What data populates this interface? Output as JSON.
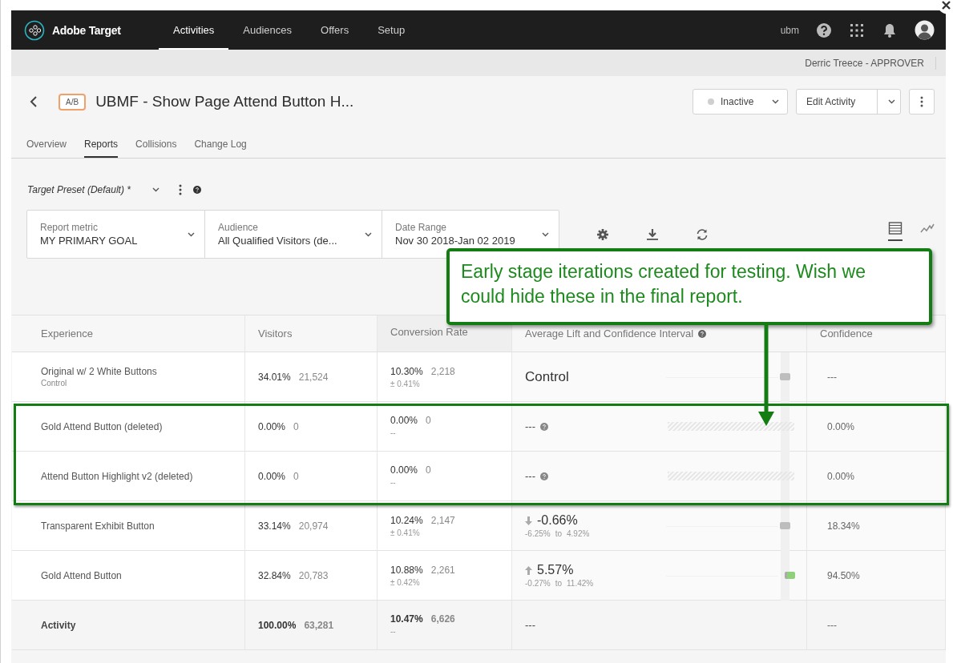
{
  "app": {
    "name": "Adobe Target"
  },
  "nav": [
    {
      "label": "Activities",
      "selected": true
    },
    {
      "label": "Audiences",
      "selected": false
    },
    {
      "label": "Offers",
      "selected": false
    },
    {
      "label": "Setup",
      "selected": false
    }
  ],
  "account": {
    "org": "ubm"
  },
  "user": {
    "name": "Derric Treece - APPROVER"
  },
  "activity": {
    "type": "A/B",
    "title": "UBMF - Show Page Attend Button H...",
    "status": "Inactive",
    "edit_button": "Edit Activity"
  },
  "tabs": [
    {
      "label": "Overview",
      "selected": false
    },
    {
      "label": "Reports",
      "selected": true
    },
    {
      "label": "Collisions",
      "selected": false
    },
    {
      "label": "Change Log",
      "selected": false
    }
  ],
  "preset": {
    "label": "Target Preset (Default) *"
  },
  "filters": [
    {
      "label": "Report metric",
      "value": "MY PRIMARY GOAL"
    },
    {
      "label": "Audience",
      "value": "All Qualified Visitors (de..."
    },
    {
      "label": "Date Range",
      "value": "Nov 30 2018-Jan 02 2019"
    }
  ],
  "views": [
    {
      "kind": "table",
      "selected": true
    },
    {
      "kind": "chart",
      "selected": false
    }
  ],
  "table": {
    "columns": [
      {
        "label": "Experience",
        "sorted": false,
        "help": false
      },
      {
        "label": "Visitors",
        "sorted": false,
        "help": false
      },
      {
        "label": "Conversion Rate",
        "sorted": true,
        "help": false
      },
      {
        "label": "Average Lift and Confidence Interval",
        "sorted": false,
        "help": true
      },
      {
        "label": "Confidence",
        "sorted": false,
        "help": false
      }
    ],
    "rows": [
      {
        "kind": "control",
        "name": "Original w/ 2 White Buttons",
        "note": "Control",
        "visitors_pct": "34.01%",
        "visitors": "21,524",
        "rate": "10.30%",
        "conversions": "2,218",
        "rate_interval": "± 0.41%",
        "lift": "Control",
        "confidence": "---",
        "highlighted": false
      },
      {
        "kind": "empty",
        "name": "Gold Attend Button (deleted)",
        "visitors_pct": "0.00%",
        "visitors": "0",
        "rate": "0.00%",
        "conversions": "0",
        "rate_interval": "--",
        "lift": "---",
        "confidence": "0.00%",
        "highlighted": true
      },
      {
        "kind": "empty",
        "name": "Attend Button Highlight v2 (deleted)",
        "visitors_pct": "0.00%",
        "visitors": "0",
        "rate": "0.00%",
        "conversions": "0",
        "rate_interval": "--",
        "lift": "---",
        "confidence": "0.00%",
        "highlighted": true
      },
      {
        "kind": "down",
        "name": "Transparent Exhibit Button",
        "visitors_pct": "33.14%",
        "visitors": "20,974",
        "rate": "10.24%",
        "conversions": "2,147",
        "rate_interval": "± 0.41%",
        "lift": "-0.66%",
        "lift_low": "-6.25%",
        "lift_to": "to",
        "lift_high": "4.92%",
        "confidence": "18.34%",
        "highlighted": false
      },
      {
        "kind": "up",
        "name": "Gold Attend Button",
        "visitors_pct": "32.84%",
        "visitors": "20,783",
        "rate": "10.88%",
        "conversions": "2,261",
        "rate_interval": "± 0.42%",
        "lift": "5.57%",
        "lift_low": "-0.27%",
        "lift_to": "to",
        "lift_high": "11.42%",
        "confidence": "94.50%",
        "highlighted": false
      },
      {
        "kind": "total",
        "name": "Activity",
        "visitors_pct": "100.00%",
        "visitors": "63,281",
        "rate": "10.47%",
        "conversions": "6,626",
        "rate_interval": "--",
        "lift": "---",
        "confidence": "---",
        "highlighted": false
      }
    ]
  },
  "callout": {
    "text": "Early stage iterations created for testing. Wish we could hide these in the final report."
  }
}
